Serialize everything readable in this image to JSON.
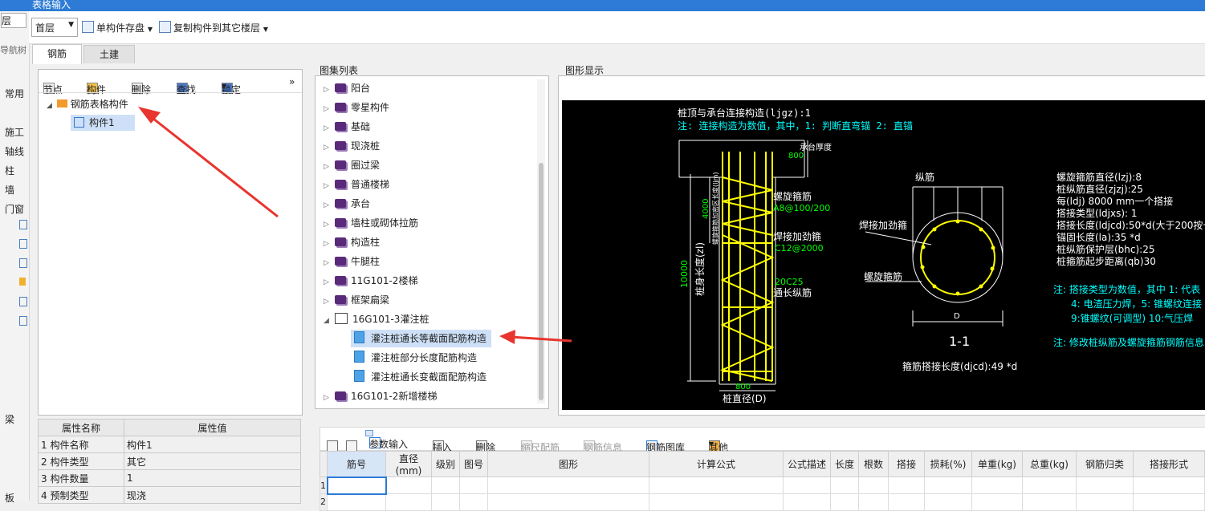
{
  "window": {
    "title": "表格输入"
  },
  "leftnav": {
    "top_field": "层",
    "header": "导航树",
    "items": [
      "常用",
      "施工",
      "轴线",
      "柱",
      "墙",
      "门窗",
      "梁",
      "板"
    ]
  },
  "toolbar": {
    "floor": "首层",
    "save_label": "单构件存盘",
    "copy_label": "复制构件到其它楼层"
  },
  "tabs": [
    "钢筋",
    "土建"
  ],
  "tree_toolbar": {
    "node": "节点",
    "component": "构件",
    "delete": "删除",
    "find": "查找",
    "lock": "锁定",
    "more": "»"
  },
  "tree": {
    "root": "钢筋表格构件",
    "child": "构件1"
  },
  "props": {
    "headers": [
      "属性名称",
      "属性值"
    ],
    "rows": [
      {
        "n": "1",
        "name": "构件名称",
        "value": "构件1"
      },
      {
        "n": "2",
        "name": "构件类型",
        "value": "其它"
      },
      {
        "n": "3",
        "name": "构件数量",
        "value": "1"
      },
      {
        "n": "4",
        "name": "预制类型",
        "value": "现浇"
      }
    ]
  },
  "atlas": {
    "title": "图集列表",
    "items": [
      "阳台",
      "零星构件",
      "基础",
      "现浇桩",
      "圈过梁",
      "普通楼梯",
      "承台",
      "墙柱或砌体拉筋",
      "构造柱",
      "牛腿柱",
      "11G101-2楼梯",
      "框架扁梁"
    ],
    "open_group": "16G101-3灌注桩",
    "sub_items": [
      "灌注桩通长等截面配筋构造",
      "灌注桩部分长度配筋构造",
      "灌注桩通长变截面配筋构造"
    ],
    "last_item": "16G101-2新增楼梯"
  },
  "figure": {
    "title": "图形显示",
    "line1": "桩顶与承台连接构造(ljgz):1",
    "line2": "注: 连接构造为数值，其中，1: 判断直弯锚    2: 直锚",
    "dim_800_top": "800",
    "label_chengtai": "承台厚度",
    "label_luoxuan": "螺旋箍筋",
    "val_luoxuan": "A8@100/200",
    "label_hanjie": "焊接加劲箍",
    "val_hanjie": "C12@2000",
    "label_tongchang": "通长纵筋",
    "val_tongchang": "20C25",
    "dim_4000": "4000",
    "label_jiami": "螺旋箍筋加密区长度(ljm)",
    "dim_10000": "10000",
    "label_zhuchang": "桩身长度(zl)",
    "dim_800_bottom": "800",
    "label_zhijing": "桩直径(D)",
    "sec_zongjin": "纵筋",
    "sec_hanjie": "焊接加劲箍",
    "sec_luoxuan": "螺旋箍筋",
    "sec_d": "D",
    "sec_name": "1-1",
    "djcd": "箍筋搭接长度(djcd):49 *d",
    "params": [
      "螺旋箍筋直径(lzj):8",
      "桩纵筋直径(zjzj):25",
      "每(ldj) 8000 mm一个搭接",
      "搭接类型(ldjxs): 1",
      "搭接长度(ldjcd):50*d(大于200按长",
      "锚固长度(la):35 *d",
      "桩纵筋保护层(bhc):25",
      "桩箍筋起步距离(qb)30"
    ],
    "note1": "注: 搭接类型为数值，其中 1: 代表",
    "note2": "4: 电渣压力焊，5: 锥螺纹连接",
    "note3": "9:锥螺纹(可调型) 10:气压焊",
    "note4": "注: 修改桩纵筋及螺旋箍筋钢筋信息"
  },
  "bottom_toolbar": {
    "param_input": "参数输入",
    "insert": "插入",
    "delete": "删除",
    "scale": "缩尺配筋",
    "rebar_info": "钢筋信息",
    "rebar_lib": "钢筋图库",
    "other": "其他"
  },
  "grid": {
    "headers": [
      "筋号",
      "直径(mm)",
      "级别",
      "图号",
      "图形",
      "计算公式",
      "公式描述",
      "长度",
      "根数",
      "搭接",
      "损耗(%)",
      "单重(kg)",
      "总重(kg)",
      "钢筋归类",
      "搭接形式"
    ],
    "rows": [
      "1",
      "2"
    ]
  },
  "colors": {
    "accent": "#2d7bd6",
    "arrow": "#e8352e",
    "cad_bg": "#000000",
    "cad_yellow": "#ffff00",
    "cad_green": "#00ff00",
    "cad_cyan": "#00ffff"
  }
}
